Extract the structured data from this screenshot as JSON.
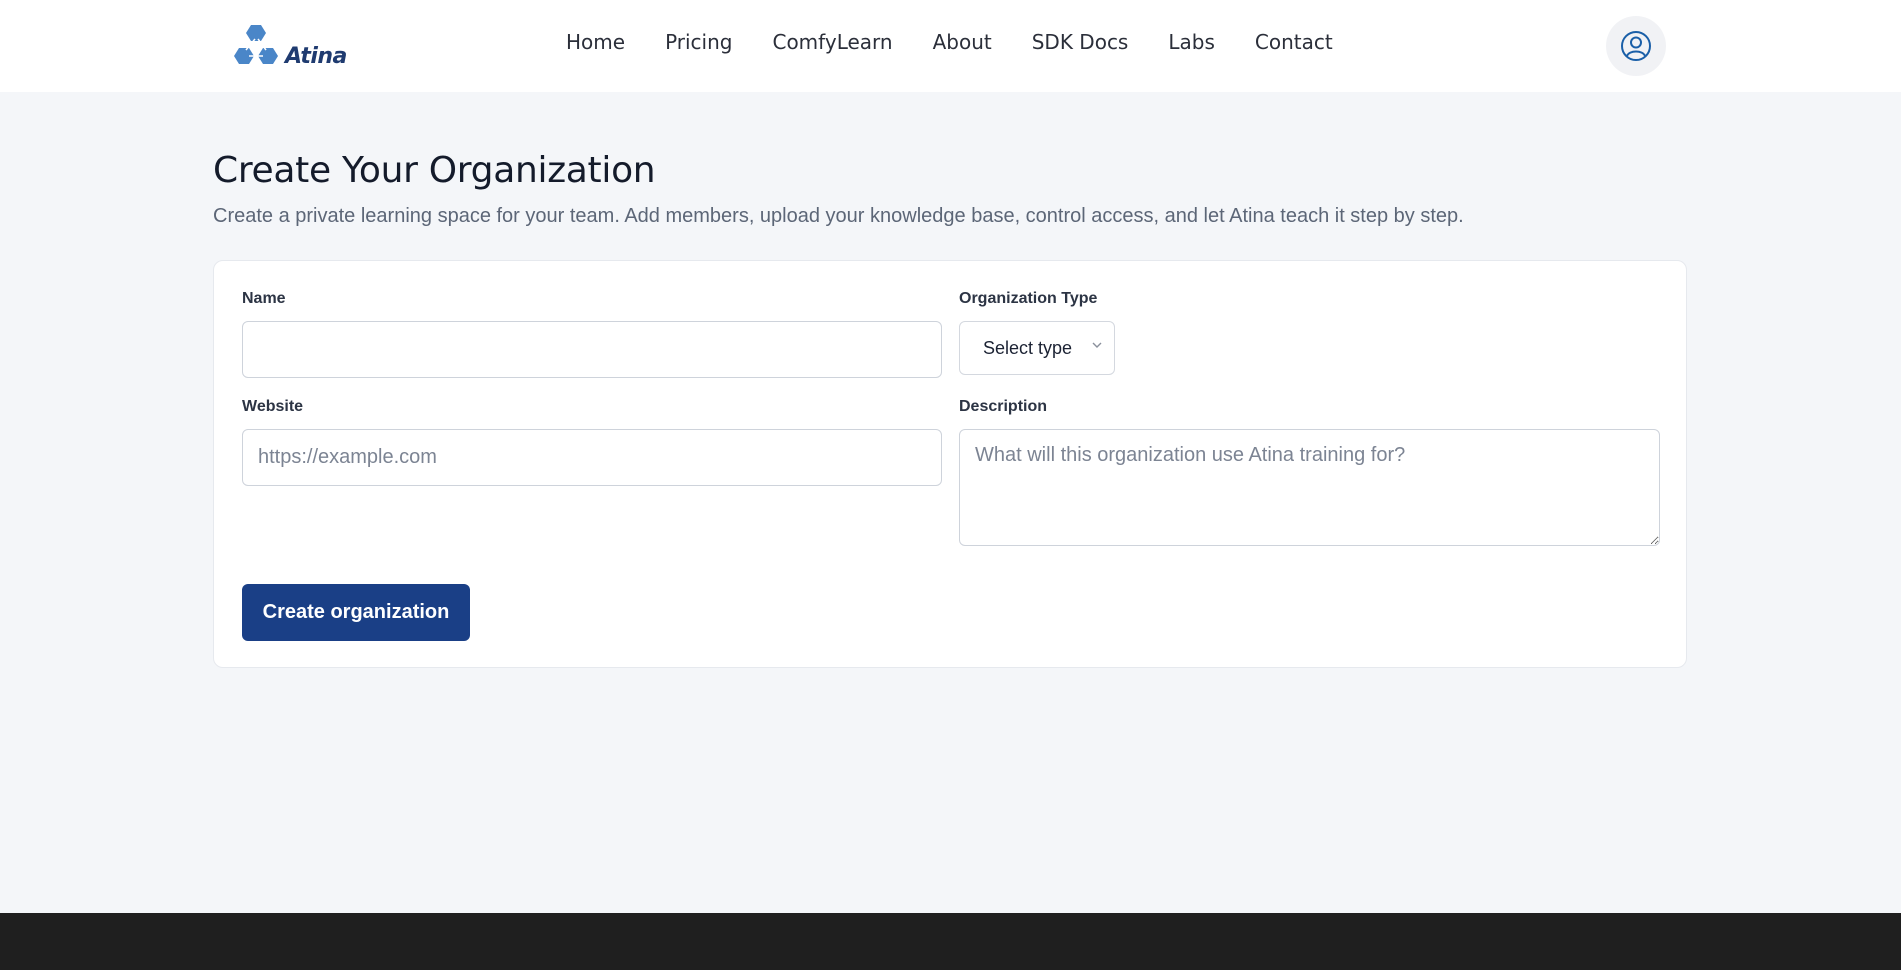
{
  "brand": {
    "logo_text": "Atina",
    "logo_color": "#1f3b70",
    "logo_mark_color": "#4a86c8"
  },
  "nav": {
    "items": [
      {
        "label": "Home"
      },
      {
        "label": "Pricing"
      },
      {
        "label": "ComfyLearn"
      },
      {
        "label": "About"
      },
      {
        "label": "SDK Docs"
      },
      {
        "label": "Labs"
      },
      {
        "label": "Contact"
      }
    ],
    "profile_icon": "user-circle-icon"
  },
  "page": {
    "title": "Create Your Organization",
    "subtitle": "Create a private learning space for your team. Add members, upload your knowledge base, control access, and let Atina teach it step by step."
  },
  "form": {
    "name": {
      "label": "Name",
      "value": "",
      "placeholder": ""
    },
    "organization_type": {
      "label": "Organization Type",
      "selected": "Select type"
    },
    "website": {
      "label": "Website",
      "value": "",
      "placeholder": "https://example.com"
    },
    "description": {
      "label": "Description",
      "value": "",
      "placeholder": "What will this organization use Atina training for?"
    },
    "submit_label": "Create organization"
  },
  "colors": {
    "page_background": "#f4f6f9",
    "primary_button": "#1a3f86",
    "footer": "#1f1f1f",
    "profile_icon": "#1a5fa8"
  }
}
